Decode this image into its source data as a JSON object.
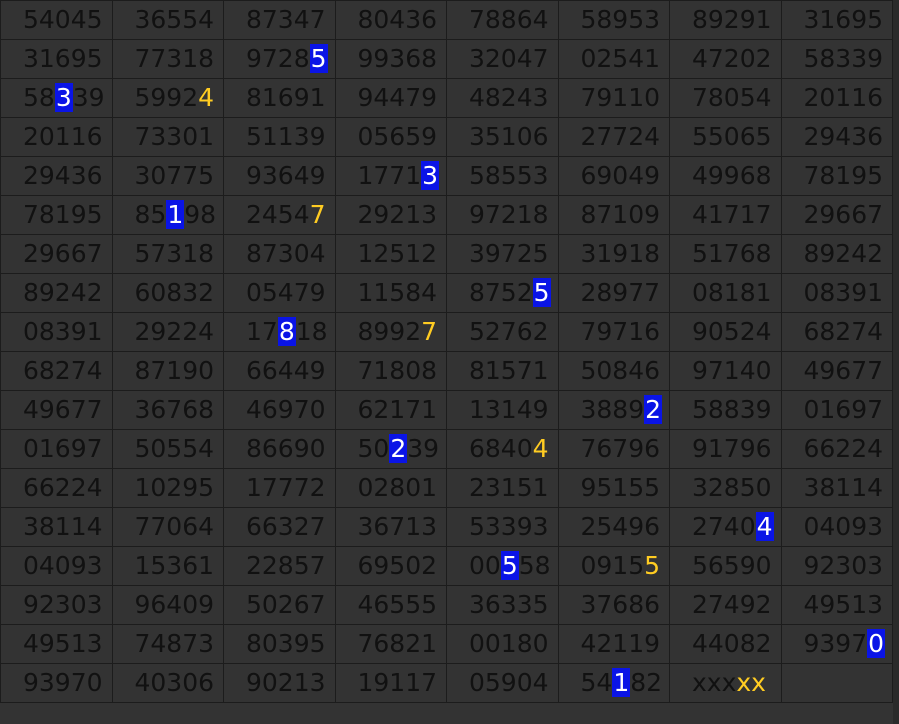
{
  "colors": {
    "background": "#333333",
    "text": "#111111",
    "highlight_box": "#0a14e6",
    "highlight_box_text": "#ffffff",
    "highlight_text": "#ffcc22",
    "grid_line": "#1c1c1c"
  },
  "rows": [
    [
      {
        "t": "54045"
      },
      {
        "t": "36554"
      },
      {
        "t": "87347"
      },
      {
        "t": "80436"
      },
      {
        "t": "78864"
      },
      {
        "t": "58953"
      },
      {
        "t": "89291"
      },
      {
        "t": "31695"
      }
    ],
    [
      {
        "t": "31695"
      },
      {
        "t": "77318"
      },
      {
        "t": "97285",
        "b": 4
      },
      {
        "t": "99368"
      },
      {
        "t": "32047"
      },
      {
        "t": "02541"
      },
      {
        "t": "47202"
      },
      {
        "t": "58339"
      }
    ],
    [
      {
        "t": "58339",
        "b": 2
      },
      {
        "t": "59924",
        "y": [
          4,
          6
        ]
      },
      {
        "t": "81691"
      },
      {
        "t": "94479"
      },
      {
        "t": "48243"
      },
      {
        "t": "79110"
      },
      {
        "t": "78054"
      },
      {
        "t": "20116"
      }
    ],
    [
      {
        "t": "20116"
      },
      {
        "t": "73301"
      },
      {
        "t": "51139"
      },
      {
        "t": "05659"
      },
      {
        "t": "35106"
      },
      {
        "t": "27724"
      },
      {
        "t": "55065"
      },
      {
        "t": "29436"
      }
    ],
    [
      {
        "t": "29436"
      },
      {
        "t": "30775"
      },
      {
        "t": "93649"
      },
      {
        "t": "17713",
        "b": 4
      },
      {
        "t": "58553"
      },
      {
        "t": "69049"
      },
      {
        "t": "49968"
      },
      {
        "t": "78195"
      }
    ],
    [
      {
        "t": "78195"
      },
      {
        "t": "85198",
        "b": 2
      },
      {
        "t": "24547",
        "y": [
          4,
          6
        ]
      },
      {
        "t": "29213"
      },
      {
        "t": "97218"
      },
      {
        "t": "87109"
      },
      {
        "t": "41717"
      },
      {
        "t": "29667"
      }
    ],
    [
      {
        "t": "29667"
      },
      {
        "t": "57318"
      },
      {
        "t": "87304"
      },
      {
        "t": "12512"
      },
      {
        "t": "39725"
      },
      {
        "t": "31918"
      },
      {
        "t": "51768"
      },
      {
        "t": "89242"
      }
    ],
    [
      {
        "t": "89242"
      },
      {
        "t": "60832"
      },
      {
        "t": "05479"
      },
      {
        "t": "11584"
      },
      {
        "t": "87525",
        "b": 4
      },
      {
        "t": "28977"
      },
      {
        "t": "08181"
      },
      {
        "t": "08391"
      }
    ],
    [
      {
        "t": "08391"
      },
      {
        "t": "29224"
      },
      {
        "t": "17818",
        "b": 2
      },
      {
        "t": "89927",
        "y": [
          4,
          6
        ]
      },
      {
        "t": "52762"
      },
      {
        "t": "79716"
      },
      {
        "t": "90524"
      },
      {
        "t": "68274"
      }
    ],
    [
      {
        "t": "68274"
      },
      {
        "t": "87190"
      },
      {
        "t": "66449"
      },
      {
        "t": "71808"
      },
      {
        "t": "81571"
      },
      {
        "t": "50846"
      },
      {
        "t": "97140"
      },
      {
        "t": "49677"
      }
    ],
    [
      {
        "t": "49677"
      },
      {
        "t": "36768"
      },
      {
        "t": "46970"
      },
      {
        "t": "62171"
      },
      {
        "t": "13149"
      },
      {
        "t": "38892",
        "b": 4
      },
      {
        "t": "58839"
      },
      {
        "t": "01697"
      }
    ],
    [
      {
        "t": "01697"
      },
      {
        "t": "50554"
      },
      {
        "t": "86690"
      },
      {
        "t": "50239",
        "b": 2
      },
      {
        "t": "68404",
        "y": [
          4,
          6
        ]
      },
      {
        "t": "76796"
      },
      {
        "t": "91796"
      },
      {
        "t": "66224"
      }
    ],
    [
      {
        "t": "66224"
      },
      {
        "t": "10295"
      },
      {
        "t": "17772"
      },
      {
        "t": "02801"
      },
      {
        "t": "23151"
      },
      {
        "t": "95155"
      },
      {
        "t": "32850"
      },
      {
        "t": "38114"
      }
    ],
    [
      {
        "t": "38114"
      },
      {
        "t": "77064"
      },
      {
        "t": "66327"
      },
      {
        "t": "36713"
      },
      {
        "t": "53393"
      },
      {
        "t": "25496"
      },
      {
        "t": "27404",
        "b": 4
      },
      {
        "t": "04093"
      }
    ],
    [
      {
        "t": "04093"
      },
      {
        "t": "15361"
      },
      {
        "t": "22857"
      },
      {
        "t": "69502"
      },
      {
        "t": "00558",
        "b": 2
      },
      {
        "t": "09155",
        "y": [
          4,
          6
        ]
      },
      {
        "t": "56590"
      },
      {
        "t": "92303"
      }
    ],
    [
      {
        "t": "92303"
      },
      {
        "t": "96409"
      },
      {
        "t": "50267"
      },
      {
        "t": "46555"
      },
      {
        "t": "36335"
      },
      {
        "t": "37686"
      },
      {
        "t": "27492"
      },
      {
        "t": "49513"
      }
    ],
    [
      {
        "t": "49513"
      },
      {
        "t": "74873"
      },
      {
        "t": "80395"
      },
      {
        "t": "76821"
      },
      {
        "t": "00180"
      },
      {
        "t": "42119"
      },
      {
        "t": "44082"
      },
      {
        "t": "93970",
        "b": 4
      }
    ],
    [
      {
        "t": "93970"
      },
      {
        "t": "40306"
      },
      {
        "t": "90213"
      },
      {
        "t": "19117"
      },
      {
        "t": "05904"
      },
      {
        "t": "54182",
        "b": 2
      },
      {
        "t": "xxxxx",
        "y": [
          3,
          5
        ]
      },
      {
        "t": ""
      }
    ]
  ]
}
